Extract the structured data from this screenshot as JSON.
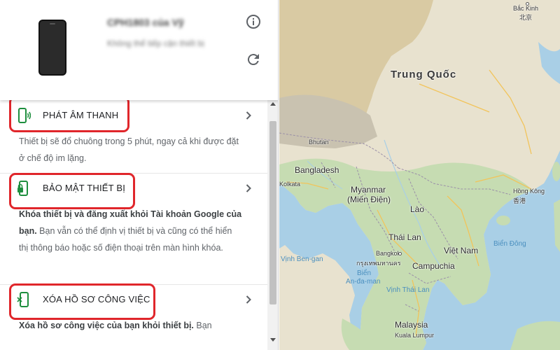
{
  "device": {
    "name": "CPH1803 của Vỹ",
    "status": "Không thể tiếp cận thiết bị"
  },
  "actions": [
    {
      "label": "PHÁT ÂM THANH",
      "icon": "phone-ring-icon",
      "desc_bold": "",
      "desc": "Thiết bị sẽ đổ chuông trong 5 phút, ngay cả khi được đặt ở chế độ im lặng."
    },
    {
      "label": "BẢO MẬT THIẾT BỊ",
      "icon": "phone-lock-icon",
      "desc_bold": "Khóa thiết bị và đăng xuất khỏi Tài khoản Google của bạn.",
      "desc": " Bạn vẫn có thể định vị thiết bị và cũng có thể hiển thị thông báo hoặc số điện thoại trên màn hình khóa."
    },
    {
      "label": "XÓA HỒ SƠ CÔNG VIỆC",
      "icon": "phone-erase-icon",
      "desc_bold": "Xóa hồ sơ công việc của bạn khỏi thiết bị.",
      "desc": " Bạn"
    }
  ],
  "map": {
    "labels": {
      "china": "Trung Quốc",
      "beijing": "Bắc Kinh",
      "beijing_cn": "北京",
      "bhutan": "Bhutan",
      "bangladesh": "Bangladesh",
      "kolkata": "Kolkata",
      "myanmar": "Myanmar",
      "myanmar_alt": "(Miến Điện)",
      "laos": "Lào",
      "thailand": "Thái Lan",
      "bangkok": "Bangkok",
      "bangkok_th": "กรุงเทพมหานคร",
      "vietnam": "Việt Nam",
      "cambodia": "Campuchia",
      "hongkong": "Hồng Kông",
      "hongkong_cn": "香港",
      "bien_dong": "Biển Đông",
      "bay_of_bengal": "Vịnh Ben-gan",
      "andaman_1": "Biển",
      "andaman_2": "An-đa-man",
      "gulf_thailand": "Vịnh Thái Lan",
      "malaysia": "Malaysia",
      "kuala_lumpur": "Kuala Lumpur"
    }
  }
}
